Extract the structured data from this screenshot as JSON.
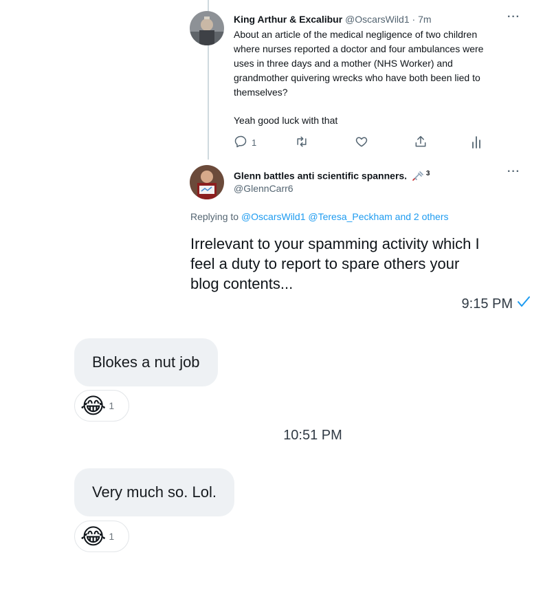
{
  "tweet1": {
    "author_name": "King Arthur & Excalibur",
    "handle": "@OscarsWild1",
    "separator": "·",
    "time": "7m",
    "more": "···",
    "body_lines": [
      "About an article of the medical negligence of two children",
      "where nurses reported a doctor and four ambulances were",
      "uses in three days and a mother (NHS Worker) and",
      "grandmother quivering wrecks who have both been lied to",
      "themselves?"
    ],
    "body_last": "Yeah good luck with that",
    "reply_count": "1"
  },
  "tweet2": {
    "author_name": "Glenn battles anti scientific spanners.",
    "name_icon": "syringe-icon",
    "badge_number": "3",
    "handle": "@GlennCarr6",
    "more": "···",
    "replying_prefix": "Replying to",
    "replying_users": "@OscarsWild1 @Teresa_Peckham",
    "replying_and": "and",
    "replying_others": "2 others",
    "body_lines": [
      "Irrelevant to your spamming activity which I",
      "feel a duty to report to spare others your",
      "blog contents..."
    ]
  },
  "sent_message": {
    "time": "9:15 PM",
    "status_icon": "checkmark-icon"
  },
  "messages": [
    {
      "text": "Blokes a nut job",
      "reaction_emoji": "😂",
      "reaction_count": "1"
    },
    {
      "text": "Very much so. Lol.",
      "reaction_emoji": "😂",
      "reaction_count": "1"
    }
  ],
  "divider_time": "10:51 PM",
  "colors": {
    "link": "#1d9bf0",
    "muted": "#536471",
    "bubble": "#eef1f4",
    "thread_line": "#cfd9de"
  }
}
